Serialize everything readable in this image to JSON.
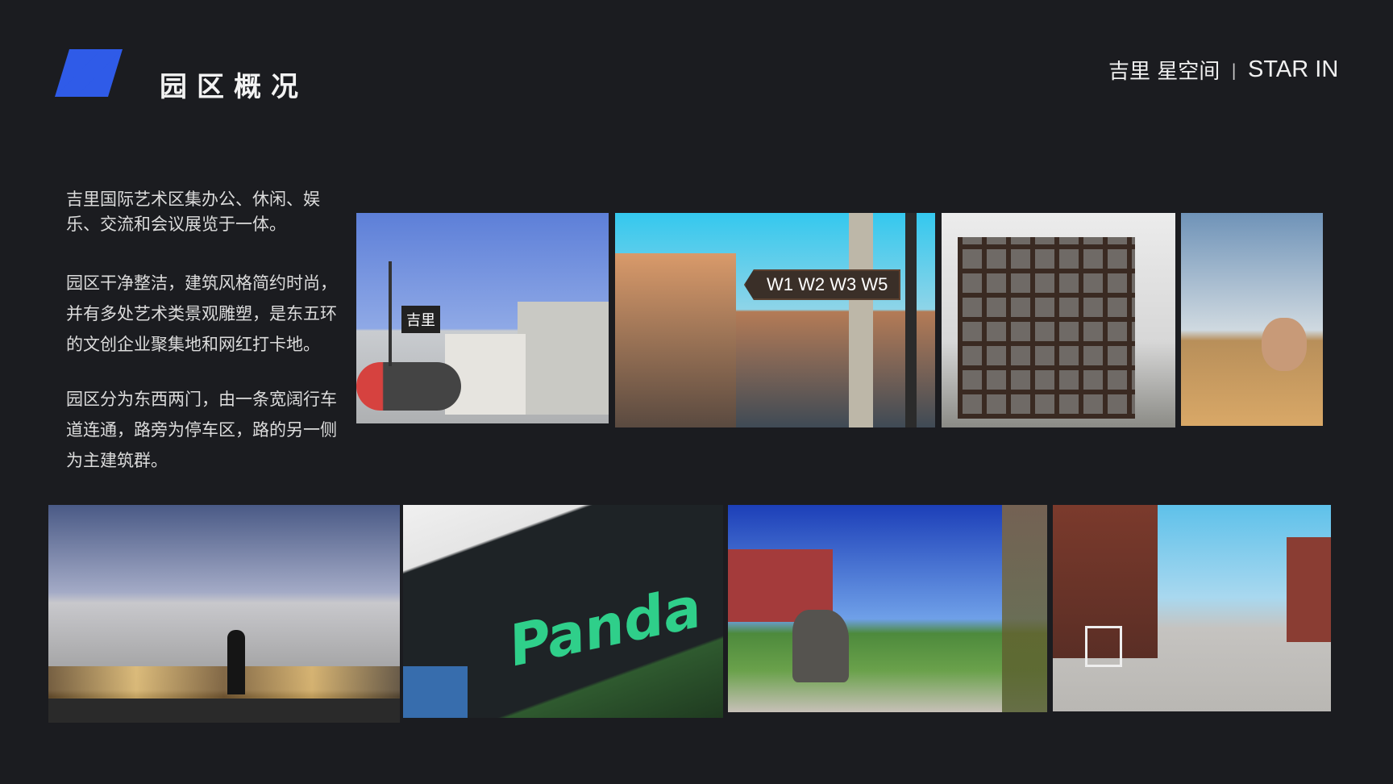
{
  "header": {
    "title": "园区概况",
    "brand_cn": "吉里 星空间",
    "brand_sep": "|",
    "brand_en": "STAR IN",
    "accent_color": "#2f5be8"
  },
  "description": {
    "paragraphs": [
      "吉里国际艺术区集办公、休闲、娱乐、交流和会议展览于一体。",
      "园区干净整洁，建筑风格简约时尚，并有多处艺术类景观雕塑，是东五环的文创企业聚集地和网红打卡地。",
      "园区分为东西两门，由一条宽阔行车道连通，路旁为停车区，路的另一侧为主建筑群。"
    ]
  },
  "photos": {
    "top": [
      {
        "subject": "entrance-gate",
        "sign_text": "吉里"
      },
      {
        "subject": "street-sign",
        "sign_text": "W1 W2 W3 W5"
      },
      {
        "subject": "cage-sculpture"
      },
      {
        "subject": "head-sculpture"
      }
    ],
    "bottom": [
      {
        "subject": "building-at-dusk"
      },
      {
        "subject": "graffiti-wall",
        "sign_text": "Panda"
      },
      {
        "subject": "garden-path"
      },
      {
        "subject": "main-road"
      }
    ]
  }
}
